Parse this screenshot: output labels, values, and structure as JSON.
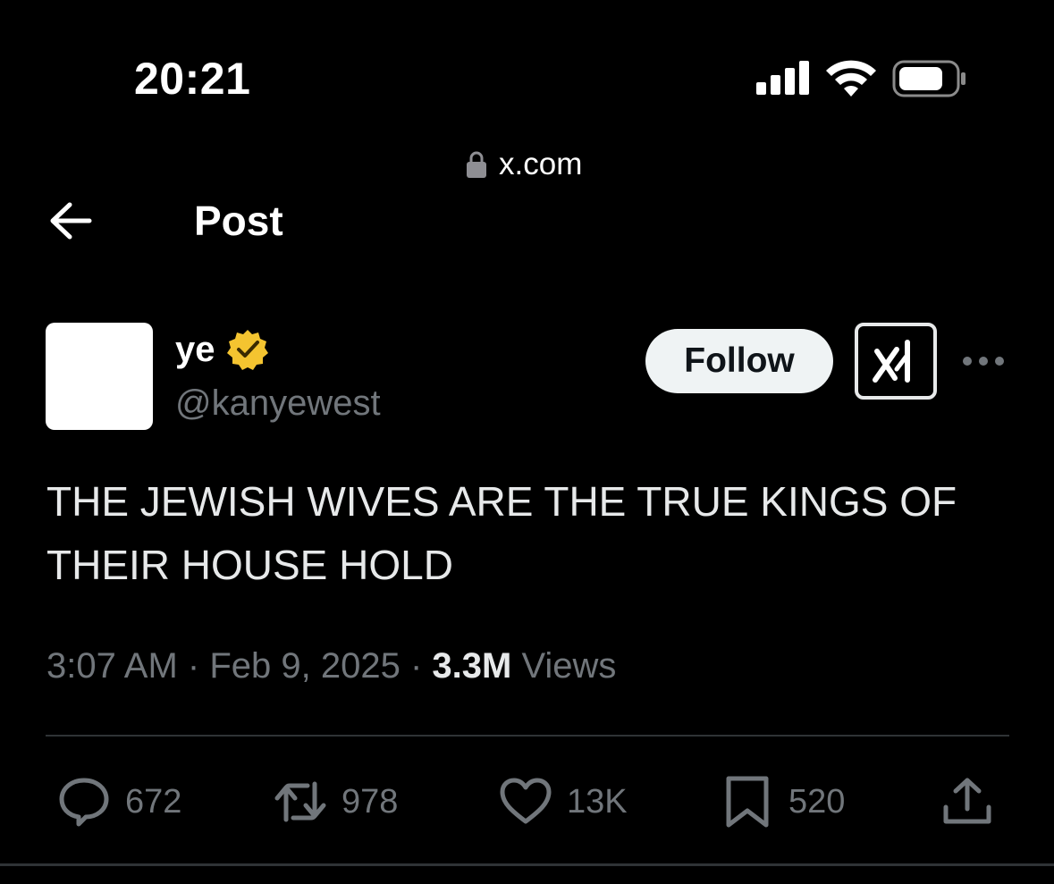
{
  "status_bar": {
    "time": "20:21"
  },
  "browser": {
    "url": "x.com"
  },
  "header": {
    "title": "Post"
  },
  "author": {
    "display_name": "ye",
    "handle": "@kanyewest",
    "verified_color": "#F4C430"
  },
  "follow_label": "Follow",
  "post": {
    "text": "THE JEWISH WIVES ARE THE TRUE KINGS OF THEIR HOUSE HOLD",
    "time": "3:07 AM",
    "date": "Feb 9, 2025",
    "views_count": "3.3M",
    "views_label": "Views"
  },
  "actions": {
    "replies": "672",
    "reposts": "978",
    "likes": "13K",
    "bookmarks": "520"
  },
  "colors": {
    "background": "#000000",
    "text": "#E7E9EA",
    "secondary": "#71767B",
    "divider": "#2F3336",
    "follow_bg": "#EFF3F4"
  }
}
